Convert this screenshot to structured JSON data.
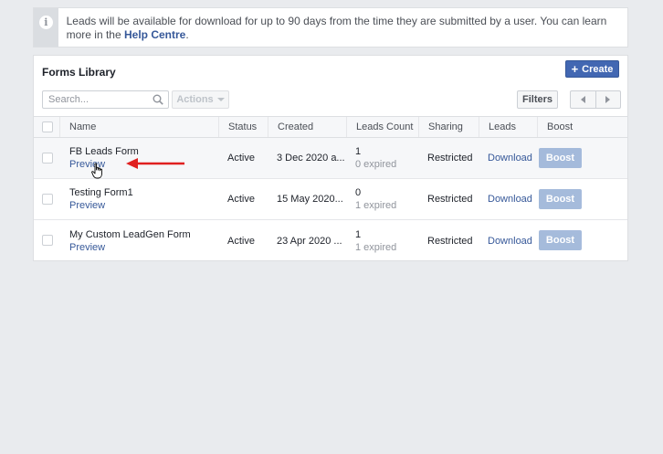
{
  "notice": {
    "text": "Leads will be available for download for up to 90 days from the time they are submitted by a user. You can learn more in the ",
    "link": "Help Centre",
    "suffix": "."
  },
  "library": {
    "title": "Forms Library",
    "create_label": "Create",
    "search_placeholder": "Search...",
    "actions_label": "Actions",
    "filters_label": "Filters"
  },
  "columns": [
    "Name",
    "Status",
    "Created",
    "Leads Count",
    "Sharing",
    "Leads",
    "Boost"
  ],
  "rows": [
    {
      "name": "FB Leads Form",
      "preview": "Preview",
      "status": "Active",
      "created": "3 Dec 2020 a...",
      "count": "1",
      "expired": "0 expired",
      "sharing": "Restricted",
      "leads": "Download",
      "boost": "Boost"
    },
    {
      "name": "Testing Form1",
      "preview": "Preview",
      "status": "Active",
      "created": "15 May 2020...",
      "count": "0",
      "expired": "1 expired",
      "sharing": "Restricted",
      "leads": "Download",
      "boost": "Boost"
    },
    {
      "name": "My Custom LeadGen Form",
      "preview": "Preview",
      "status": "Active",
      "created": "23 Apr 2020 ...",
      "count": "1",
      "expired": "1 expired",
      "sharing": "Restricted",
      "leads": "Download",
      "boost": "Boost"
    }
  ],
  "colors": {
    "accent": "#4267b2",
    "link": "#365899",
    "arrow": "#e02020",
    "boost_disabled": "#9cb4d8"
  }
}
